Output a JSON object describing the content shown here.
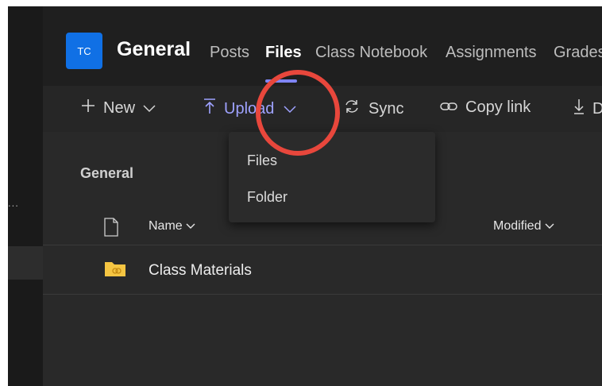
{
  "sidebar": {
    "more_label": "..."
  },
  "header": {
    "avatar_initials": "TC",
    "team_name": "General",
    "tabs": [
      {
        "label": "Posts"
      },
      {
        "label": "Files"
      },
      {
        "label": "Class Notebook"
      },
      {
        "label": "Assignments"
      },
      {
        "label": "Grades"
      }
    ],
    "active_tab": "Files"
  },
  "toolbar": {
    "new_label": "New",
    "upload_label": "Upload",
    "sync_label": "Sync",
    "copy_link_label": "Copy link",
    "download_label": "D"
  },
  "upload_menu": {
    "items": [
      {
        "label": "Files"
      },
      {
        "label": "Folder"
      }
    ]
  },
  "content": {
    "section_title": "General",
    "columns": {
      "name": "Name",
      "modified": "Modified"
    },
    "rows": [
      {
        "name": "Class Materials",
        "type": "folder"
      }
    ]
  },
  "colors": {
    "accent": "#7f85f5",
    "avatar": "#1070e5",
    "annotation": "#e8473c",
    "folder": "#f5c542"
  }
}
